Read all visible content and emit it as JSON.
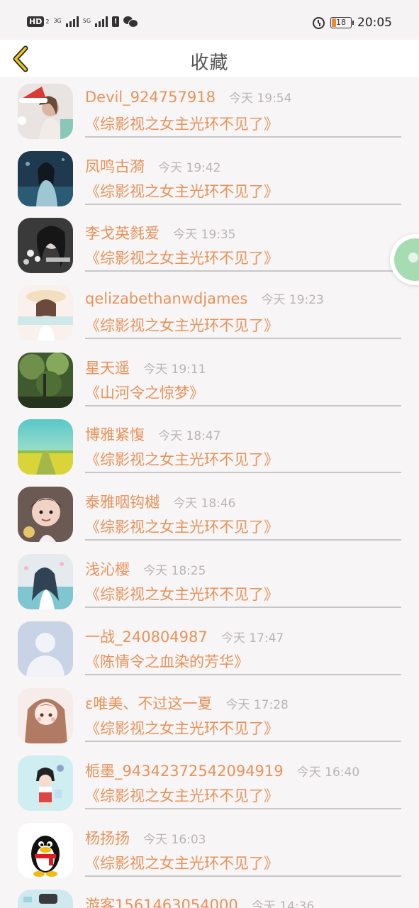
{
  "status_bar": {
    "hd": "HD",
    "hd_sub": "2",
    "net1": "3G",
    "net2": "5G",
    "battery": "18",
    "time": "20:05"
  },
  "header": {
    "title": "收藏",
    "back_icon": "chevron-left-icon"
  },
  "colors": {
    "accent": "#e7935a",
    "time_gray": "#b9b5b5",
    "back_yellow": "#f0c21e"
  },
  "items": [
    {
      "name": "Devil_924757918",
      "time": "今天 19:54",
      "book": "《综影视之女主光环不见了》"
    },
    {
      "name": "凤鸣古漪",
      "time": "今天 19:42",
      "book": "《综影视之女主光环不见了》"
    },
    {
      "name": "李戈英毵爱",
      "time": "今天 19:35",
      "book": "《综影视之女主光环不见了》"
    },
    {
      "name": "qelizabethanwdjames",
      "time": "今天 19:23",
      "book": "《综影视之女主光环不见了》"
    },
    {
      "name": "星天遥",
      "time": "今天 19:11",
      "book": "《山河令之惊梦》"
    },
    {
      "name": "博雅紧愎",
      "time": "今天 18:47",
      "book": "《综影视之女主光环不见了》"
    },
    {
      "name": "泰雅咽钩樾",
      "time": "今天 18:46",
      "book": "《综影视之女主光环不见了》"
    },
    {
      "name": "浅沁樱",
      "time": "今天 18:25",
      "book": "《综影视之女主光环不见了》"
    },
    {
      "name": "一战_240804987",
      "time": "今天 17:47",
      "book": "《陈情令之血染的芳华》"
    },
    {
      "name": "ɛ唯美、不过这一夏",
      "time": "今天 17:28",
      "book": "《综影视之女主光环不见了》"
    },
    {
      "name": "栀墨_94342372542094919",
      "time": "今天 16:40",
      "book": "《综影视之女主光环不见了》"
    },
    {
      "name": "杨扬扬",
      "time": "今天 16:03",
      "book": "《综影视之女主光环不见了》"
    },
    {
      "name": "游客1561463054000",
      "time": "今天 14:36",
      "book": ""
    }
  ]
}
